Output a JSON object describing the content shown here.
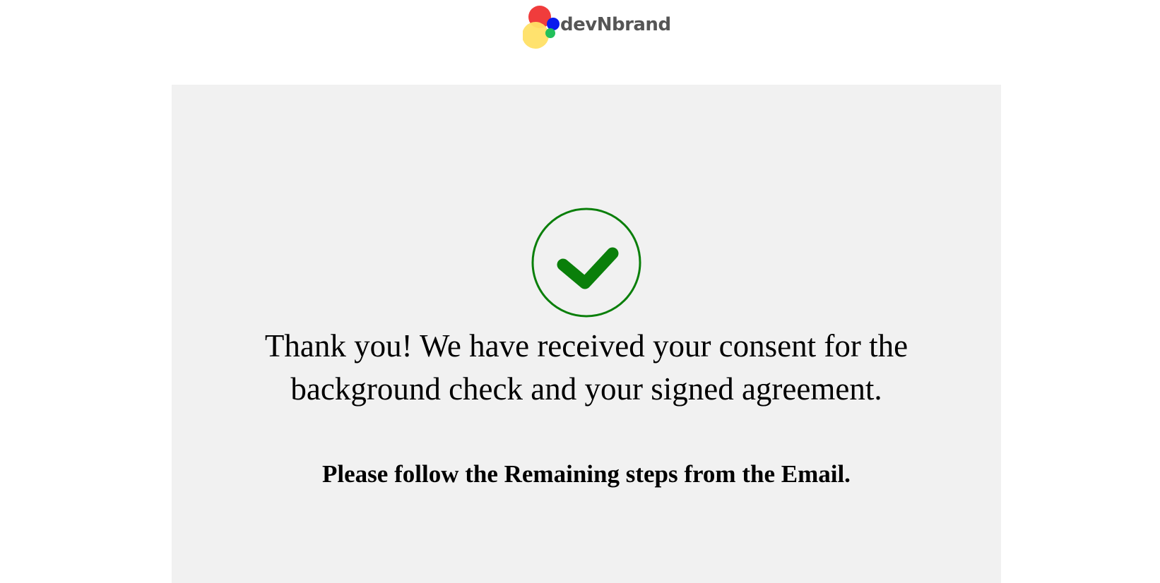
{
  "brand": {
    "name": "devNbrand",
    "colors": {
      "red": "#f03c3c",
      "blue": "#0a1aee",
      "yellow": "#ffe066",
      "green": "#22c05a",
      "text": "#555555"
    }
  },
  "confirmation": {
    "icon": "check-circle-icon",
    "icon_color": "#0a7f0a",
    "message_line1": "Thank you! We have received your consent for the",
    "message_line2": "background check and your signed agreement.",
    "next_steps": "Please follow the Remaining steps from the Email."
  },
  "colors": {
    "page_background": "#ffffff",
    "card_background": "#f1f1f1"
  }
}
